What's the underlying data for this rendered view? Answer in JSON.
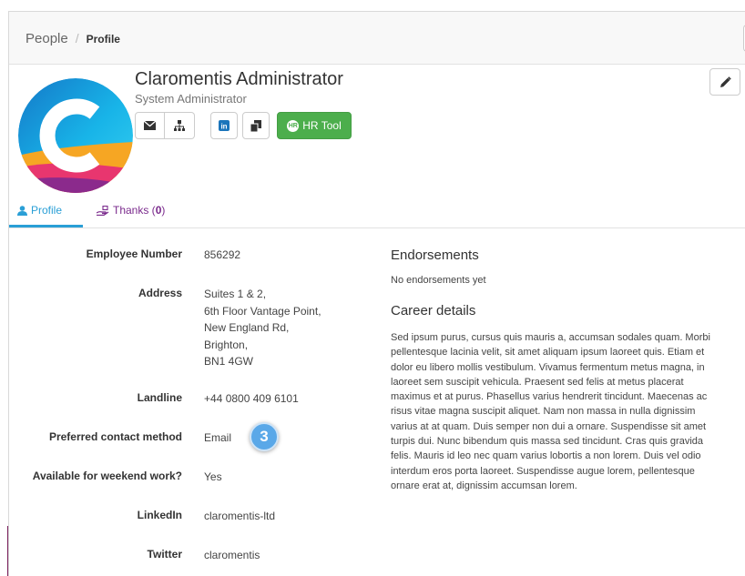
{
  "breadcrumb": {
    "parent": "People",
    "separator": "/",
    "current": "Profile"
  },
  "profile": {
    "name": "Claromentis Administrator",
    "role": "System Administrator",
    "actions": [
      {
        "icon": "envelope-icon"
      },
      {
        "icon": "org-chart-icon"
      },
      {
        "icon": "linkedin-icon"
      },
      {
        "icon": "documents-icon"
      }
    ],
    "hr_button": {
      "label": "HR Tool",
      "icon_text": "HR"
    }
  },
  "tabs": {
    "profile": "Profile",
    "thanks_label": "Thanks (",
    "thanks_count": "0",
    "thanks_close": ")"
  },
  "fields": {
    "employee_number": {
      "label": "Employee Number",
      "value": "856292"
    },
    "address": {
      "label": "Address",
      "lines": [
        "Suites 1 & 2,",
        "6th Floor Vantage Point,",
        "New England Rd,",
        "Brighton,",
        "BN1 4GW"
      ]
    },
    "landline": {
      "label": "Landline",
      "value": "+44 0800 409 6101"
    },
    "preferred_contact": {
      "label": "Preferred contact method",
      "value": "Email"
    },
    "weekend_work": {
      "label": "Available for weekend work?",
      "value": "Yes"
    },
    "linkedin": {
      "label": "LinkedIn",
      "value": "claromentis-ltd"
    },
    "twitter": {
      "label": "Twitter",
      "value": "claromentis"
    }
  },
  "step_badge": "3",
  "endorsements": {
    "title": "Endorsements",
    "text": "No endorsements yet"
  },
  "career": {
    "title": "Career details",
    "lines": [
      "Sed ipsum purus, cursus quis mauris a, accumsan sodales quam. Morbi",
      "pellentesque lacinia velit, sit amet aliquam ipsum laoreet quis. Etiam et",
      "dolor eu libero mollis vestibulum. Vivamus fermentum metus magna, in",
      "laoreet sem suscipit vehicula. Praesent sed felis at metus placerat",
      "maximus et at purus. Phasellus varius hendrerit tincidunt. Maecenas ac",
      "risus vitae magna suscipit aliquet. Nam non massa in nulla dignissim",
      "varius at at quam. Duis semper non dui a ornare. Suspendisse sit amet",
      "turpis dui. Nunc bibendum quis massa sed tincidunt. Cras quis gravida",
      "felis. Mauris id leo nec quam varius lobortis a non lorem. Duis vel odio",
      "interdum eros porta laoreet. Suspendisse augue lorem, pellentesque",
      "ornare erat at, dignissim accumsan lorem."
    ]
  },
  "colors": {
    "accent": "#2a9fd6",
    "thanks": "#7a2a8c",
    "hr_green": "#4cae4c",
    "badge": "#5aa8e8"
  }
}
